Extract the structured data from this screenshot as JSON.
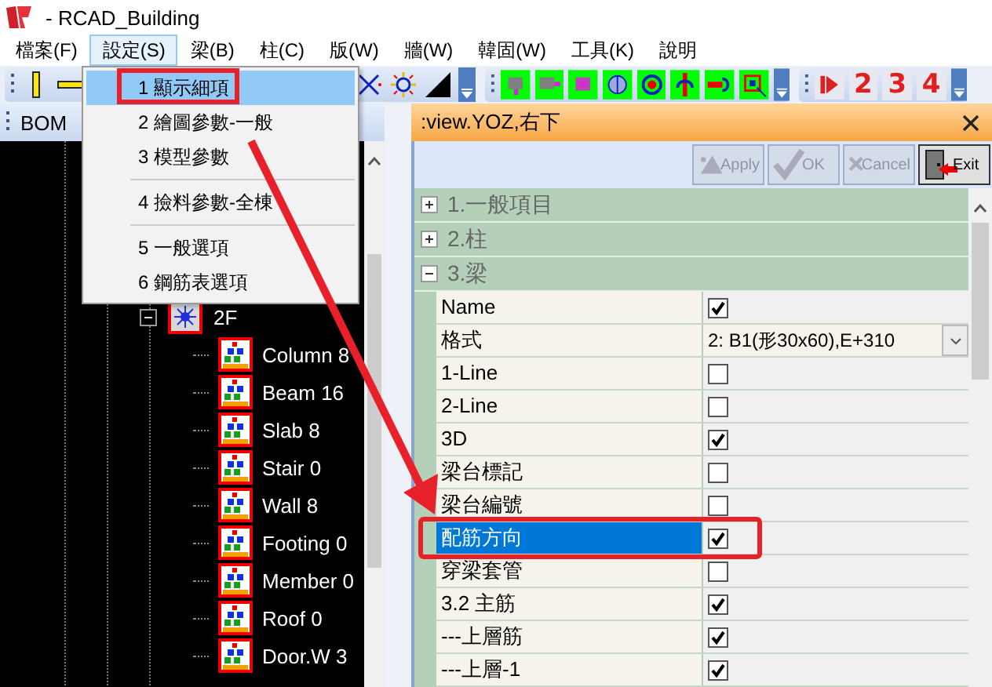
{
  "window": {
    "title": "- RCAD_Building"
  },
  "menu_bar": [
    {
      "label": "檔案(F)",
      "selected": false
    },
    {
      "label": "設定(S)",
      "selected": true
    },
    {
      "label": "梁(B)",
      "selected": false
    },
    {
      "label": "柱(C)",
      "selected": false
    },
    {
      "label": "版(W)",
      "selected": false
    },
    {
      "label": "牆(W)",
      "selected": false
    },
    {
      "label": "韓固(W)",
      "selected": false
    },
    {
      "label": "工具(K)",
      "selected": false
    },
    {
      "label": "說明",
      "selected": false
    }
  ],
  "dropdown_menu": {
    "sections": [
      [
        {
          "label": "1 顯示細項",
          "selected": true
        },
        {
          "label": "2 繪圖參數-一般",
          "selected": false
        },
        {
          "label": "3 模型參數",
          "selected": false
        }
      ],
      [
        {
          "label": "4 撿料參數-全棟",
          "selected": false
        }
      ],
      [
        {
          "label": "5 一般選項",
          "selected": false
        },
        {
          "label": "6 鋼筋表選項",
          "selected": false
        }
      ]
    ]
  },
  "toolbar": {
    "number_buttons": [
      "2",
      "3",
      "4"
    ]
  },
  "left_panel": {
    "title": "BOM",
    "tree": {
      "label": "2F",
      "expanded": true,
      "children": [
        {
          "label": "Column 8"
        },
        {
          "label": "Beam 16"
        },
        {
          "label": "Slab 8"
        },
        {
          "label": "Stair 0"
        },
        {
          "label": "Wall 8"
        },
        {
          "label": "Footing 0"
        },
        {
          "label": "Member 0"
        },
        {
          "label": "Roof 0"
        },
        {
          "label": "Door.W 3"
        }
      ]
    }
  },
  "right_panel": {
    "title": ":view.YOZ,右下",
    "buttons": [
      {
        "label": "Apply",
        "disabled": true
      },
      {
        "label": "OK",
        "disabled": true
      },
      {
        "label": "Cancel",
        "disabled": true
      },
      {
        "label": "Exit",
        "disabled": false
      }
    ],
    "groups": [
      {
        "label": "1.一般項目",
        "expanded": false
      },
      {
        "label": "2.柱",
        "expanded": false
      },
      {
        "label": "3.梁",
        "expanded": true,
        "rows": [
          {
            "label": "Name",
            "kind": "checkbox",
            "checked": true,
            "selected": false
          },
          {
            "label": "格式",
            "kind": "dropdown",
            "value": "2: B1(形30x60),E+310",
            "selected": false
          },
          {
            "label": "1-Line",
            "kind": "checkbox",
            "checked": false,
            "selected": false
          },
          {
            "label": "2-Line",
            "kind": "checkbox",
            "checked": false,
            "selected": false
          },
          {
            "label": "3D",
            "kind": "checkbox",
            "checked": true,
            "selected": false
          },
          {
            "label": "梁台標記",
            "kind": "checkbox",
            "checked": false,
            "selected": false
          },
          {
            "label": "梁台編號",
            "kind": "checkbox",
            "checked": false,
            "selected": false
          },
          {
            "label": "配筋方向",
            "kind": "checkbox",
            "checked": true,
            "selected": true
          },
          {
            "label": "穿梁套管",
            "kind": "checkbox",
            "checked": false,
            "selected": false
          },
          {
            "label": "3.2 主筋",
            "kind": "checkbox",
            "checked": true,
            "selected": false
          },
          {
            "label": "---上層筋",
            "kind": "checkbox",
            "checked": true,
            "selected": false
          },
          {
            "label": "---上層-1",
            "kind": "checkbox",
            "checked": true,
            "selected": false
          }
        ]
      }
    ]
  }
}
